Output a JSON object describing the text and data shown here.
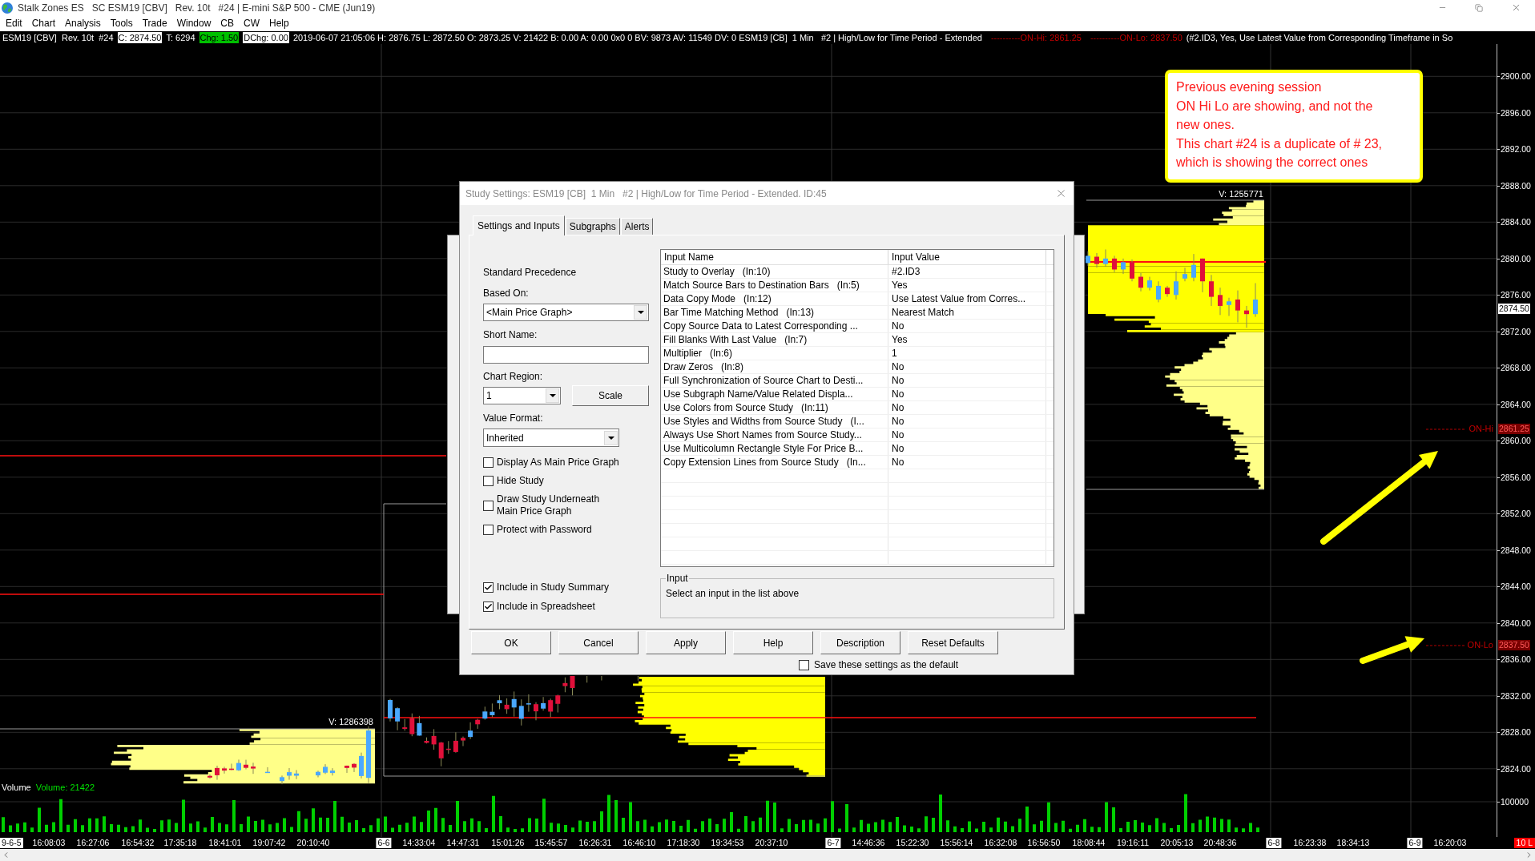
{
  "window": {
    "title": "Stalk Zones ES   SC ESM19 [CBV]   Rev. 10t   #24 | E-mini S&P 500 - CME (Jun19)"
  },
  "menu": [
    "Edit",
    "Chart",
    "Analysis",
    "Tools",
    "Trade",
    "Window",
    "CB",
    "CW",
    "Help"
  ],
  "chart_header": [
    {
      "text": "ESM19 [CBV]  Rev. 10t  #24",
      "kind": "plain"
    },
    {
      "text": "C: 2874.50",
      "kind": "highlight"
    },
    {
      "text": "T: 6294",
      "kind": "plain"
    },
    {
      "text": "Chg: 1.50",
      "kind": "up"
    },
    {
      "text": "DChg: 0.00",
      "kind": "highlight"
    },
    {
      "text": "2019-06-07 21:05:06 H: 2876.75 L: 2872.50 O: 2873.25 V: 21422 B: 0.00 A: 0.00 0x0 0 BV: 9873 AV: 11549 DV: 0 ESM19 [CB]  1 Min   #2 | High/Low for Time Period - Extended",
      "kind": "plain"
    },
    {
      "text": "----------ON-Hi: 2861.25",
      "kind": "alert"
    },
    {
      "text": "----------ON-Lo: 2837.50",
      "kind": "alert"
    },
    {
      "text": "(#2.ID3, Yes, Use Latest Value from Corresponding Timeframe in So",
      "kind": "plain"
    }
  ],
  "chart": {
    "profile_volumes": [
      "V: 1286398",
      "V: 1255771"
    ],
    "levels": [
      {
        "label": "ON-Hi",
        "price": "2861.25"
      },
      {
        "label": "ON-Lo",
        "price": "2837.50"
      }
    ],
    "volume_panel": {
      "title": "Volume",
      "reading": "Volume: 21422",
      "tick": "100000"
    }
  },
  "price_axis": {
    "ticks": [
      "2900.00",
      "2896.00",
      "2892.00",
      "2888.00",
      "2884.00",
      "2880.00",
      "2876.00",
      "2872.00",
      "2868.00",
      "2864.00",
      "2860.00",
      "2856.00",
      "2852.00",
      "2848.00",
      "2844.00",
      "2840.00",
      "2836.00",
      "2832.00",
      "2828.00",
      "2824.00"
    ],
    "current_price": "2874.50"
  },
  "note": {
    "lines": [
      "Previous evening session",
      "ON Hi Lo are showing, and not the",
      "new ones.",
      "This chart #24 is a duplicate of # 23,",
      "which is showing the correct ones"
    ]
  },
  "time_axis": {
    "labels": [
      {
        "text": "9-6-5",
        "kind": "date"
      },
      {
        "text": "16:08:03",
        "kind": "time"
      },
      {
        "text": "16:27:06",
        "kind": "time"
      },
      {
        "text": "16:54:32",
        "kind": "time"
      },
      {
        "text": "17:35:18",
        "kind": "time"
      },
      {
        "text": "18:41:01",
        "kind": "time"
      },
      {
        "text": "19:07:42",
        "kind": "time"
      },
      {
        "text": "20:10:40",
        "kind": "time"
      },
      {
        "text": "6-6",
        "kind": "date"
      },
      {
        "text": "14:33:04",
        "kind": "time"
      },
      {
        "text": "14:47:31",
        "kind": "time"
      },
      {
        "text": "15:01:26",
        "kind": "time"
      },
      {
        "text": "15:45:57",
        "kind": "time"
      },
      {
        "text": "16:26:31",
        "kind": "time"
      },
      {
        "text": "16:46:10",
        "kind": "time"
      },
      {
        "text": "17:18:30",
        "kind": "time"
      },
      {
        "text": "19:34:53",
        "kind": "time"
      },
      {
        "text": "20:37:10",
        "kind": "time"
      },
      {
        "text": "6-7",
        "kind": "date"
      },
      {
        "text": "14:46:36",
        "kind": "time"
      },
      {
        "text": "15:22:30",
        "kind": "time"
      },
      {
        "text": "15:56:14",
        "kind": "time"
      },
      {
        "text": "16:32:08",
        "kind": "time"
      },
      {
        "text": "16:56:50",
        "kind": "time"
      },
      {
        "text": "18:08:44",
        "kind": "time"
      },
      {
        "text": "19:16:11",
        "kind": "time"
      },
      {
        "text": "20:05:13",
        "kind": "time"
      },
      {
        "text": "20:48:36",
        "kind": "time"
      },
      {
        "text": "6-8",
        "kind": "date"
      },
      {
        "text": "16:23:38",
        "kind": "time"
      },
      {
        "text": "18:34:13",
        "kind": "time"
      },
      {
        "text": "6-9",
        "kind": "date"
      },
      {
        "text": "16:20:03",
        "kind": "time"
      }
    ],
    "bar_counter": "10 L"
  },
  "dialog": {
    "title": "Study Settings: ESM19 [CB]  1 Min   #2 | High/Low for Time Period - Extended. ID:45",
    "tabs": [
      {
        "label": "Settings and Inputs",
        "selected": true
      },
      {
        "label": "Subgraphs",
        "selected": false
      },
      {
        "label": "Alerts",
        "selected": false
      }
    ],
    "precedence": "Standard Precedence",
    "based_on": {
      "label": "Based On:",
      "value": "<Main Price Graph>"
    },
    "short_name": {
      "label": "Short Name:"
    },
    "chart_region": {
      "label": "Chart Region:",
      "value": "1"
    },
    "scale_button": "Scale",
    "value_format": {
      "label": "Value Format:",
      "value": "Inherited"
    },
    "options": [
      {
        "label": "Display As Main Price Graph",
        "checked": false
      },
      {
        "label": "Hide Study",
        "checked": false
      },
      {
        "label": "Draw Study Underneath Main Price Graph",
        "checked": false
      },
      {
        "label": "Protect with Password",
        "checked": false
      }
    ],
    "summary_options": [
      {
        "label": "Include in Study Summary",
        "checked": true
      },
      {
        "label": "Include in Spreadsheet",
        "checked": true
      }
    ],
    "inputs_table": {
      "columns": [
        "Input Name",
        "Input Value"
      ],
      "rows": [
        {
          "name": "Study to Overlay   (In:10)",
          "value": "#2.ID3"
        },
        {
          "name": "Match Source Bars to Destination Bars   (In:5)",
          "value": "Yes"
        },
        {
          "name": "Data Copy Mode   (In:12)",
          "value": "Use Latest Value from Corres..."
        },
        {
          "name": "Bar Time Matching Method   (In:13)",
          "value": "Nearest Match"
        },
        {
          "name": "Copy Source Data to Latest Corresponding ...",
          "value": "No"
        },
        {
          "name": "Fill Blanks With Last Value   (In:7)",
          "value": "Yes"
        },
        {
          "name": "Multiplier   (In:6)",
          "value": "1"
        },
        {
          "name": "Draw Zeros   (In:8)",
          "value": "No"
        },
        {
          "name": "Full Synchronization of Source Chart to Desti...",
          "value": "No"
        },
        {
          "name": "Use Subgraph Name/Value Related Displa...",
          "value": "No"
        },
        {
          "name": "Use Colors from Source Study   (In:11)",
          "value": "No"
        },
        {
          "name": "Use Styles and Widths from Source Study   (I...",
          "value": "No"
        },
        {
          "name": "Always Use Short Names from Source Study...",
          "value": "No"
        },
        {
          "name": "Use Multicolumn Rectangle Style For Price B...",
          "value": "No"
        },
        {
          "name": "Copy Extension Lines from Source Study   (In...",
          "value": "No"
        }
      ]
    },
    "input_group": {
      "legend": "Input",
      "text": "Select an input in the list above"
    },
    "buttons": [
      "OK",
      "Cancel",
      "Apply",
      "Help",
      "Description",
      "Reset Defaults"
    ],
    "save_default": {
      "label": "Save these settings as the default",
      "checked": false
    }
  }
}
